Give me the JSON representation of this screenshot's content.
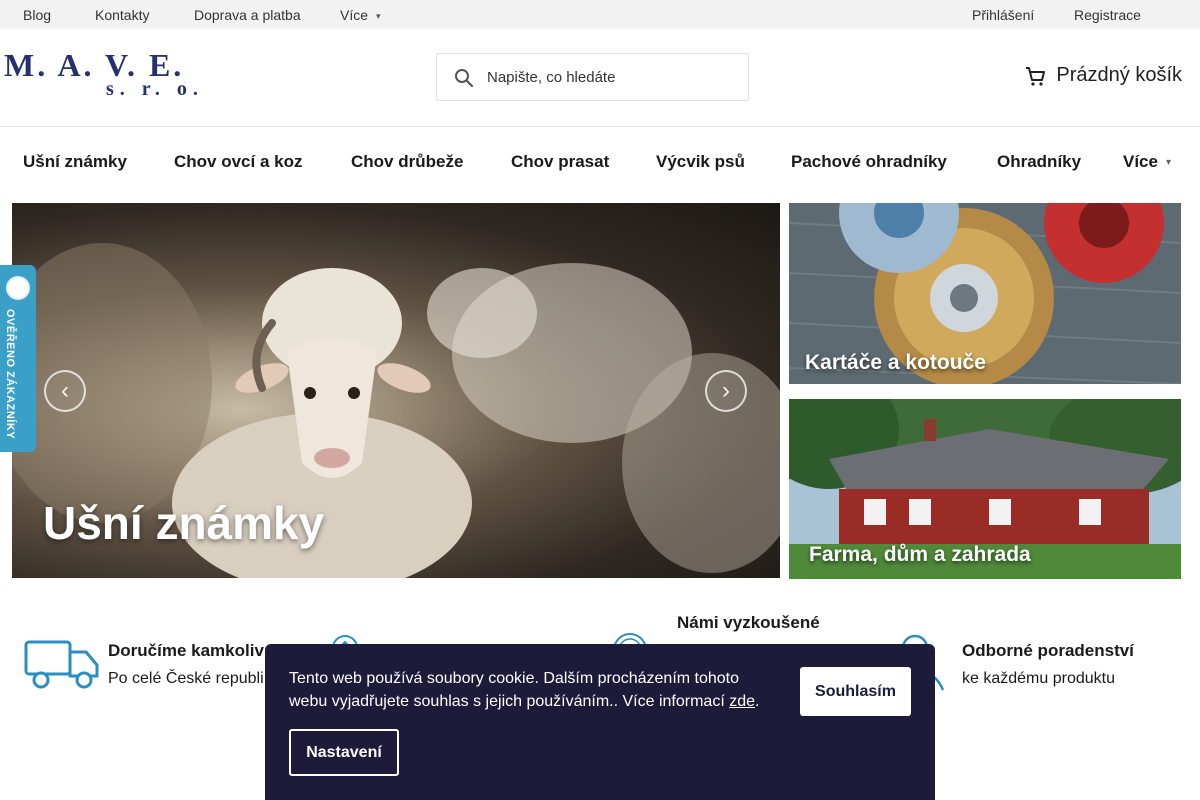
{
  "topbar": {
    "links": [
      "Blog",
      "Kontakty",
      "Doprava a platba",
      "Více"
    ],
    "login": "Přihlášení",
    "register": "Registrace"
  },
  "logo": {
    "line1": "M. A. V. E.",
    "line2": "s. r. o."
  },
  "search": {
    "placeholder": "Napište, co hledáte"
  },
  "cart": {
    "label": "Prázdný košík"
  },
  "nav": {
    "items": [
      "Ušní známky",
      "Chov ovcí a koz",
      "Chov drůbeže",
      "Chov prasat",
      "Výcvik psů",
      "Pachové ohradníky",
      "Ohradníky",
      "Více"
    ]
  },
  "hero": {
    "title": "Ušní známky"
  },
  "promos": [
    {
      "title": "Kartáče a kotouče"
    },
    {
      "title": "Farma, dům a zahrada"
    }
  ],
  "badge": {
    "text": "OVĚŘENO ZÁKAZNÍKY"
  },
  "features": [
    {
      "title": "Doručíme kamkoliv",
      "subtitle": "Po celé České republi"
    },
    {
      "title": "Námi vyzkoušené",
      "subtitle": ""
    },
    {
      "title": "Odborné poradenství",
      "subtitle": "ke každému produktu"
    }
  ],
  "cookie": {
    "text": "Tento web používá soubory cookie. Dalším procházením tohoto webu vyjadřujete souhlas s jejich používáním.. Více informací ",
    "link": "zde",
    "after": ".",
    "agree": "Souhlasím",
    "settings": "Nastavení"
  },
  "colors": {
    "brand": "#25306e",
    "accent": "#3aa0c7",
    "cookie_bg": "#1c1b3a"
  }
}
